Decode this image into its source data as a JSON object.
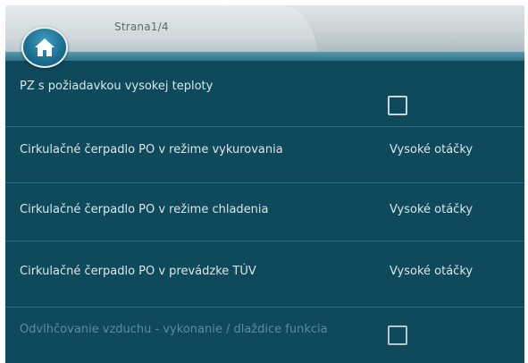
{
  "header": {
    "page_indicator": "Strana1/4",
    "home_icon": "home-icon"
  },
  "settings": [
    {
      "label": "PZ s požiadavkou vysokej teploty",
      "type": "checkbox",
      "checked": false
    },
    {
      "label": "Cirkulačné čerpadlo PO v režime vykurovania",
      "type": "value",
      "value": "Vysoké otáčky"
    },
    {
      "label": "Cirkulačné čerpadlo PO v režime chladenia",
      "type": "value",
      "value": "Vysoké otáčky"
    },
    {
      "label": "Cirkulačné čerpadlo PO v prevádzke TÚV",
      "type": "value",
      "value": "Vysoké otáčky"
    },
    {
      "label": "Odvlhčovanie vzduchu - vykonanie / dlaždice funkcia",
      "type": "checkbox",
      "checked": false,
      "disabled": true
    }
  ],
  "colors": {
    "background": "#0f4a5c",
    "text": "#d9e6ea",
    "disabled_text": "#5d8b99",
    "header": "#cfd7da"
  }
}
